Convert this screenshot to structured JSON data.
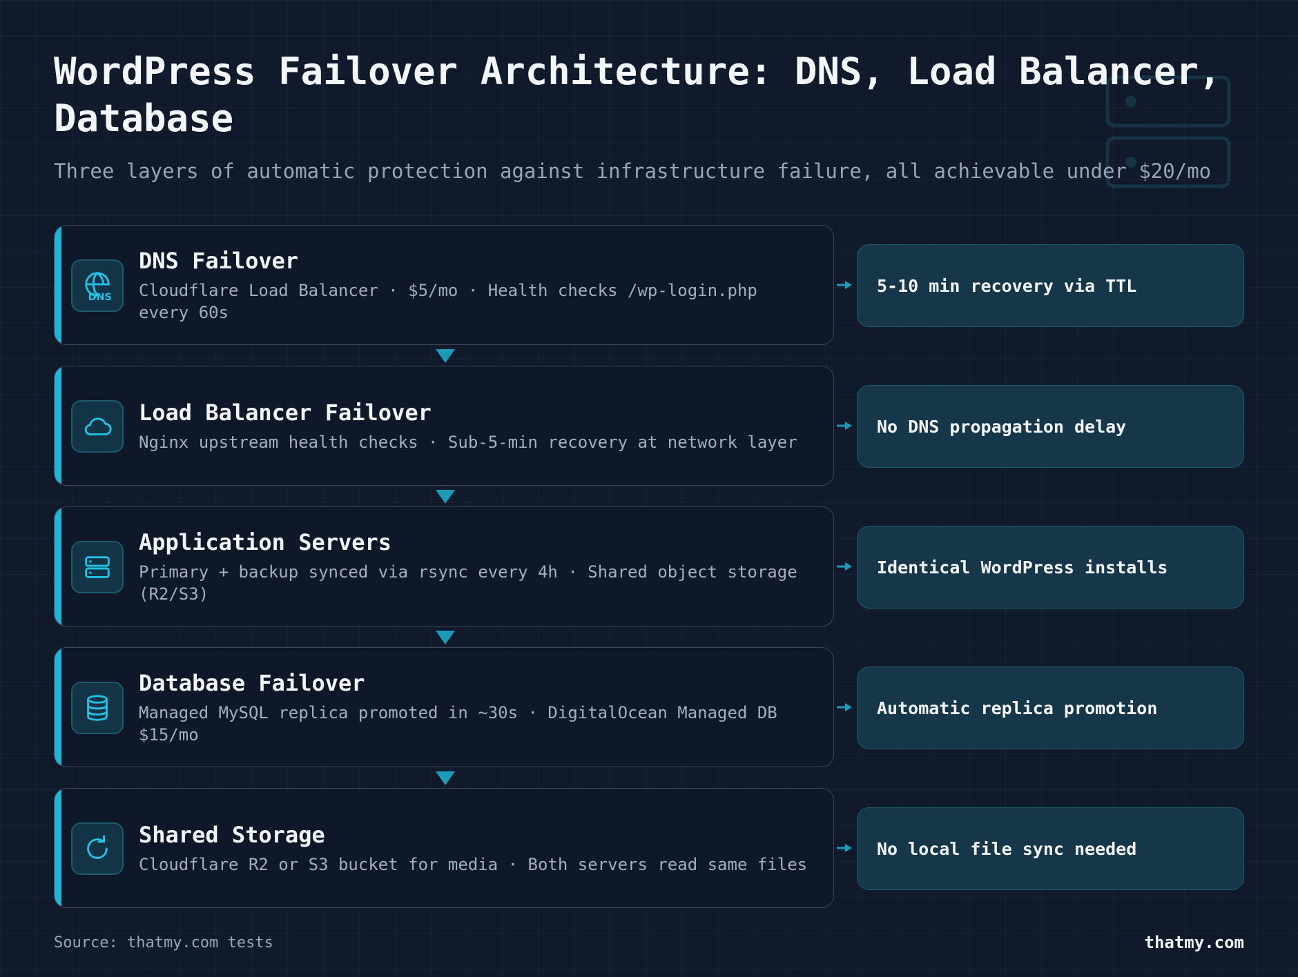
{
  "header": {
    "title": "WordPress Failover Architecture: DNS, Load Balancer, Database",
    "subtitle": "Three layers of automatic protection against infrastructure failure, all achievable under $20/mo"
  },
  "colors": {
    "background": "#111a2b",
    "card": "#0f1828",
    "accent": "#22b5d6",
    "outcome_bg": "#163649"
  },
  "steps": [
    {
      "title": "DNS Failover",
      "description": "Cloudflare Load Balancer · $5/mo · Health checks /wp-login.php every 60s",
      "icon": "globe-dns-icon",
      "outcome": "5-10 min recovery via TTL"
    },
    {
      "title": "Load Balancer Failover",
      "description": "Nginx upstream health checks · Sub-5-min recovery at network layer",
      "icon": "cloud-icon",
      "outcome": "No DNS propagation delay"
    },
    {
      "title": "Application Servers",
      "description": "Primary + backup synced via rsync every 4h · Shared object storage (R2/S3)",
      "icon": "server-icon",
      "outcome": "Identical WordPress installs"
    },
    {
      "title": "Database Failover",
      "description": "Managed MySQL replica promoted in ~30s · DigitalOcean Managed DB $15/mo",
      "icon": "database-icon",
      "outcome": "Automatic replica promotion"
    },
    {
      "title": "Shared Storage",
      "description": "Cloudflare R2 or S3 bucket for media · Both servers read same files",
      "icon": "refresh-icon",
      "outcome": "No local file sync needed"
    }
  ],
  "footer": {
    "source": "Source: thatmy.com tests",
    "brand": "thatmy.com"
  }
}
